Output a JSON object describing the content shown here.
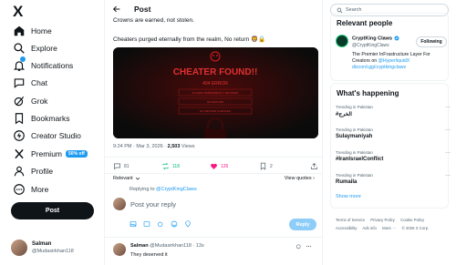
{
  "nav": {
    "logo": "X",
    "items": [
      {
        "label": "Home",
        "icon": "home-icon"
      },
      {
        "label": "Explore",
        "icon": "search-icon"
      },
      {
        "label": "Notifications",
        "icon": "bell-icon"
      },
      {
        "label": "Chat",
        "icon": "chat-icon"
      },
      {
        "label": "Grok",
        "icon": "grok-icon"
      },
      {
        "label": "Bookmarks",
        "icon": "bookmark-icon"
      },
      {
        "label": "Creator Studio",
        "icon": "lightning-icon"
      },
      {
        "label": "Premium",
        "icon": "x-icon"
      },
      {
        "label": "Profile",
        "icon": "person-icon"
      },
      {
        "label": "More",
        "icon": "more-icon"
      }
    ],
    "premium_badge": "50% off",
    "post_button": "Post",
    "account": {
      "name": "Salman",
      "handle": "@Mudasirkhan118"
    }
  },
  "main": {
    "header_title": "Post",
    "text_line1": "Crowns are earned, not stolen.",
    "text_line2": "Cheaters purged eternally from the realm, No return 🦁🔒",
    "media": {
      "headline": "CHEATER FOUND!!",
      "subheadline": "404 ERROR",
      "lines": [
        "ACCESS PERMANENTLY REVOKED",
        "NO RETURN",
        "NO SECOND CHANCES"
      ]
    },
    "meta": {
      "time": "9:24 PM · Mar 3, 2026 · ",
      "views_count": "2,503",
      "views_label": " Views"
    },
    "actions": {
      "replies": "81",
      "reposts": "118",
      "likes": "126",
      "bookmarks": "2"
    },
    "relevant_label": "Relevant",
    "view_quotes": "View quotes",
    "replying_to_prefix": "Replying to ",
    "replying_to_handle": "@CryptKingClaws",
    "reply_placeholder": "Post your reply",
    "reply_button": "Reply",
    "reply_post": {
      "name": "Salman",
      "handle": "@Mudasirkhan118",
      "time": "· 13s",
      "text": "They deserved it"
    }
  },
  "sidebar": {
    "search_placeholder": "Search",
    "relevant_people_title": "Relevant people",
    "person": {
      "name": "CryptKing Claws",
      "handle": "@CryptKingClaws",
      "follow_label": "Following",
      "bio_text": "The Premier InFrastructure Layer For Creators on ",
      "bio_link1": "@HyperliquidX",
      "bio_link2": "discord.gg/cryptkingclaws"
    },
    "happening_title": "What's happening",
    "trends": [
      {
        "context": "Trending in Pakistan",
        "title": "#الخرج"
      },
      {
        "context": "Trending in Pakistan",
        "title": "Sulaymaniyah"
      },
      {
        "context": "Trending in Pakistan",
        "title": "#IranIsraelConflict"
      },
      {
        "context": "Trending in Pakistan",
        "title": "Rumaila"
      }
    ],
    "show_more": "Show more",
    "footer": [
      "Terms of Service",
      "Privacy Policy",
      "Cookie Policy",
      "Accessibility",
      "Ads info",
      "More ···",
      "© 2026 X Corp."
    ]
  },
  "colors": {
    "accent": "#1d9bf0",
    "like": "#f91880",
    "repost": "#00ba7c",
    "text": "#0f1419",
    "muted": "#536471"
  }
}
